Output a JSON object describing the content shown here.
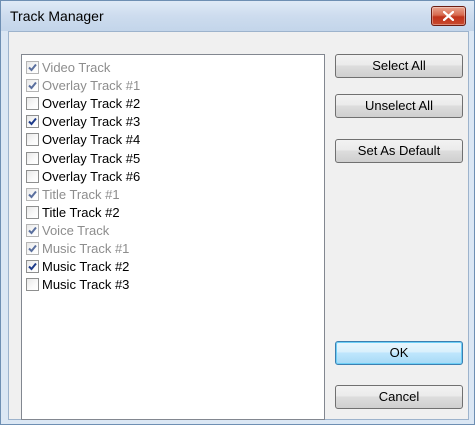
{
  "window": {
    "title": "Track Manager",
    "close_icon": "close-icon"
  },
  "tracks": [
    {
      "label": "Video Track",
      "checked": true,
      "enabled": false
    },
    {
      "label": "Overlay Track #1",
      "checked": true,
      "enabled": false
    },
    {
      "label": "Overlay Track #2",
      "checked": false,
      "enabled": true
    },
    {
      "label": "Overlay Track #3",
      "checked": true,
      "enabled": true
    },
    {
      "label": "Overlay Track #4",
      "checked": false,
      "enabled": true
    },
    {
      "label": "Overlay Track #5",
      "checked": false,
      "enabled": true
    },
    {
      "label": "Overlay Track #6",
      "checked": false,
      "enabled": true
    },
    {
      "label": "Title Track #1",
      "checked": true,
      "enabled": false
    },
    {
      "label": "Title Track #2",
      "checked": false,
      "enabled": true
    },
    {
      "label": "Voice Track",
      "checked": true,
      "enabled": false
    },
    {
      "label": "Music Track #1",
      "checked": true,
      "enabled": false
    },
    {
      "label": "Music Track #2",
      "checked": true,
      "enabled": true
    },
    {
      "label": "Music Track #3",
      "checked": false,
      "enabled": true
    }
  ],
  "buttons": {
    "select_all": "Select All",
    "unselect_all": "Unselect All",
    "set_as_default": "Set As Default",
    "ok": "OK",
    "cancel": "Cancel"
  },
  "colors": {
    "checkmark": "#1d3b8a",
    "disabled_text": "#8d8d8d"
  }
}
